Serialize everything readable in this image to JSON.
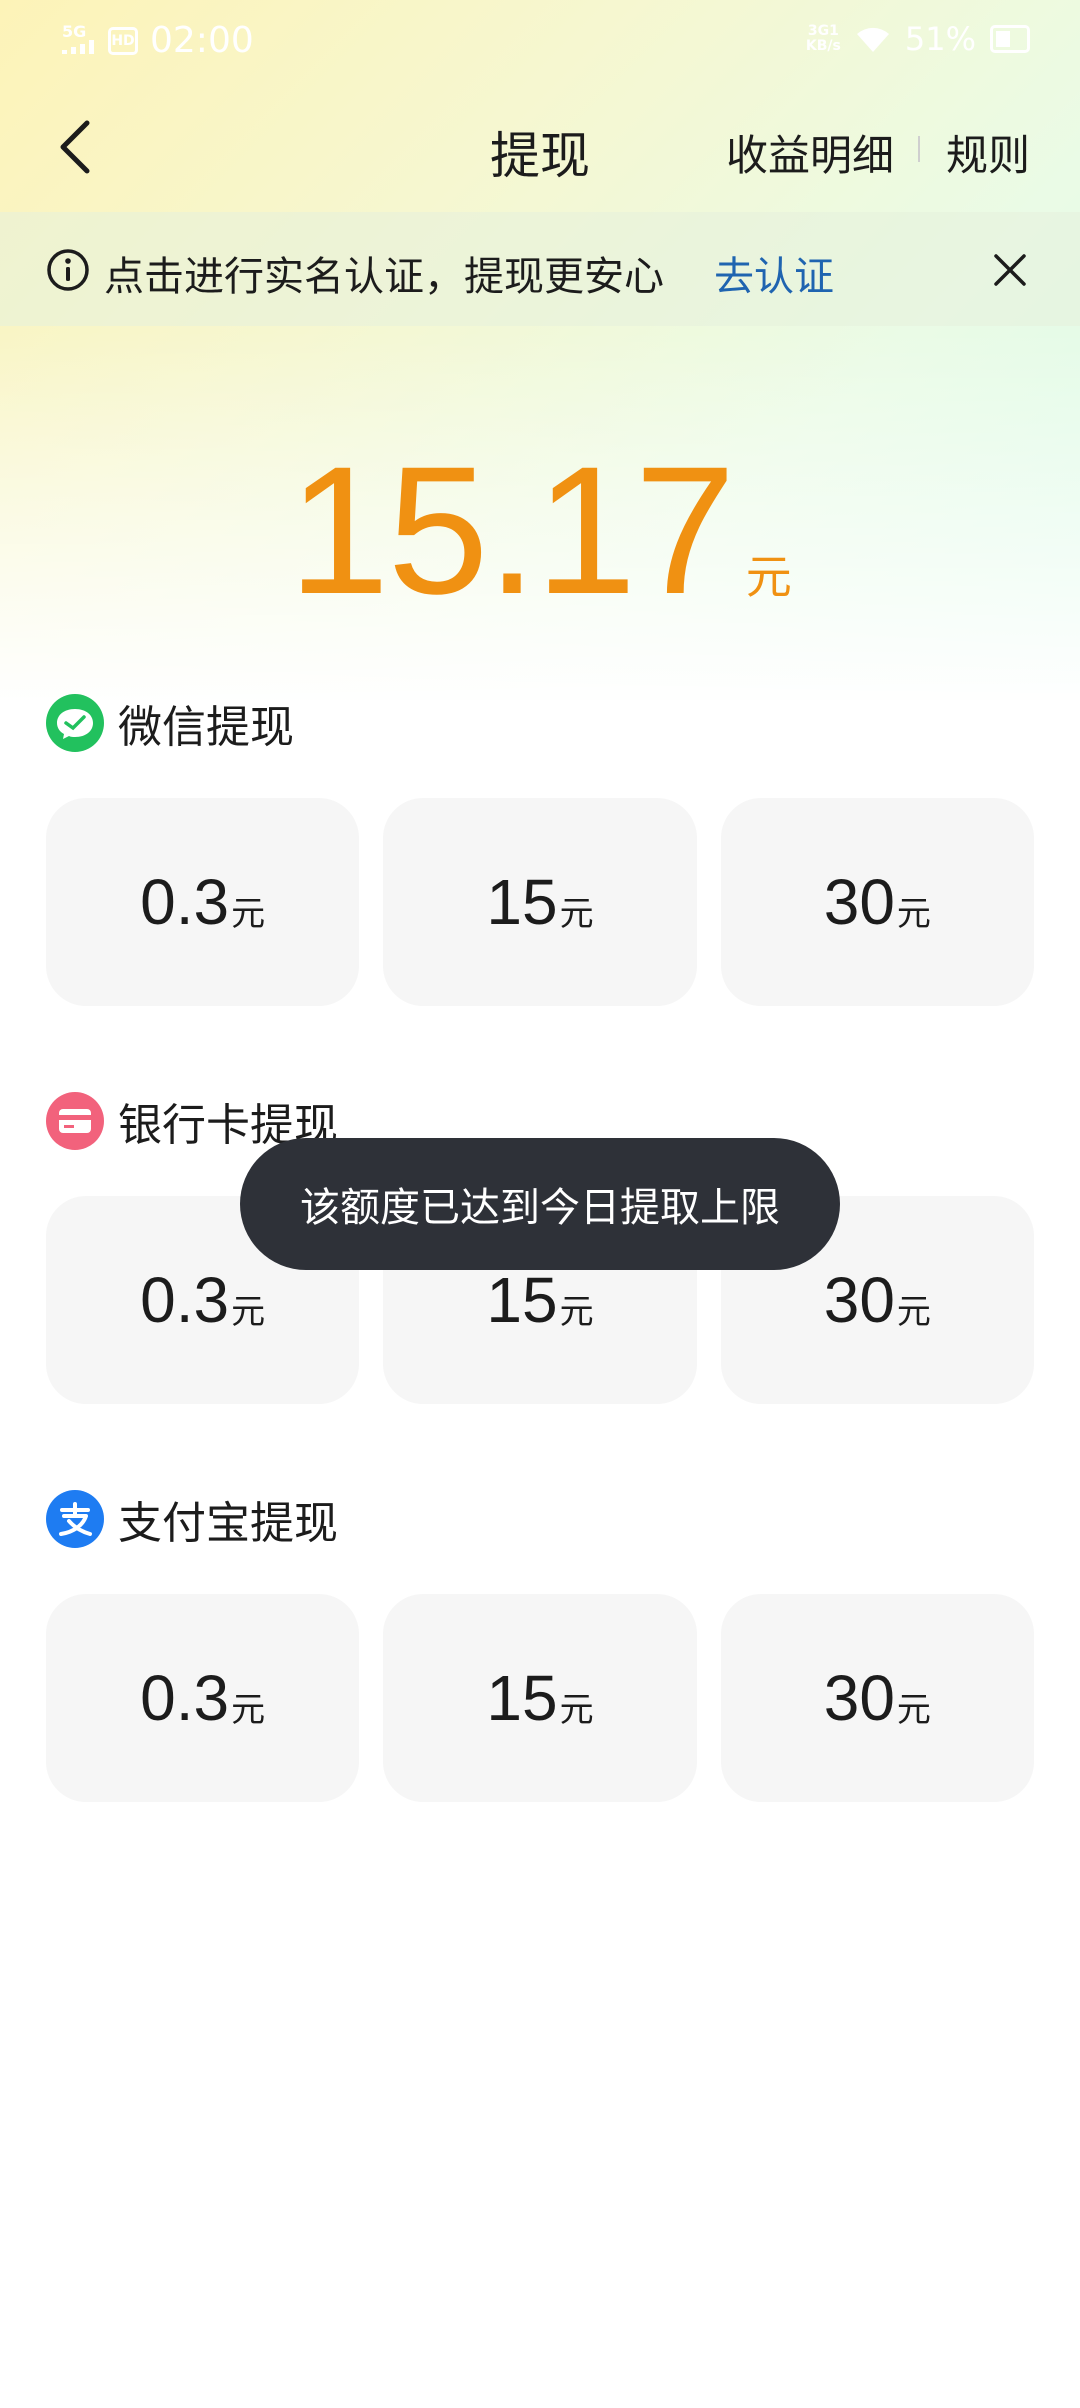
{
  "status_bar": {
    "signal": "5G",
    "time": "02:00",
    "network": "3G1\nKB/s",
    "battery": "51%",
    "icons": [
      "signal-icon",
      "sim-icon",
      "wifi-icon",
      "battery-icon"
    ]
  },
  "nav": {
    "title": "提现",
    "detail_link": "收益明细",
    "rules_link": "规则"
  },
  "banner": {
    "text": "点击进行实名认证，提现更安心",
    "action": "去认证"
  },
  "balance": {
    "value": "15.17",
    "unit": "元"
  },
  "sections": [
    {
      "title": "微信提现",
      "icon": "wechat-icon",
      "color": "#22c15e",
      "options": [
        {
          "value": "0.3",
          "unit": "元"
        },
        {
          "value": "15",
          "unit": "元"
        },
        {
          "value": "30",
          "unit": "元"
        }
      ]
    },
    {
      "title": "银行卡提现",
      "icon": "bank-card-icon",
      "color": "#f2627c",
      "options": [
        {
          "value": "0.3",
          "unit": "元"
        },
        {
          "value": "15",
          "unit": "元"
        },
        {
          "value": "30",
          "unit": "元"
        }
      ]
    },
    {
      "title": "支付宝提现",
      "icon": "alipay-icon",
      "color": "#1e7cf2",
      "options": [
        {
          "value": "0.3",
          "unit": "元"
        },
        {
          "value": "15",
          "unit": "元"
        },
        {
          "value": "30",
          "unit": "元"
        }
      ]
    }
  ],
  "toast": {
    "text": "该额度已达到今日提取上限"
  },
  "colors": {
    "accent": "#f09112",
    "link": "#1f64b0",
    "toast_bg": "#2e3138"
  }
}
